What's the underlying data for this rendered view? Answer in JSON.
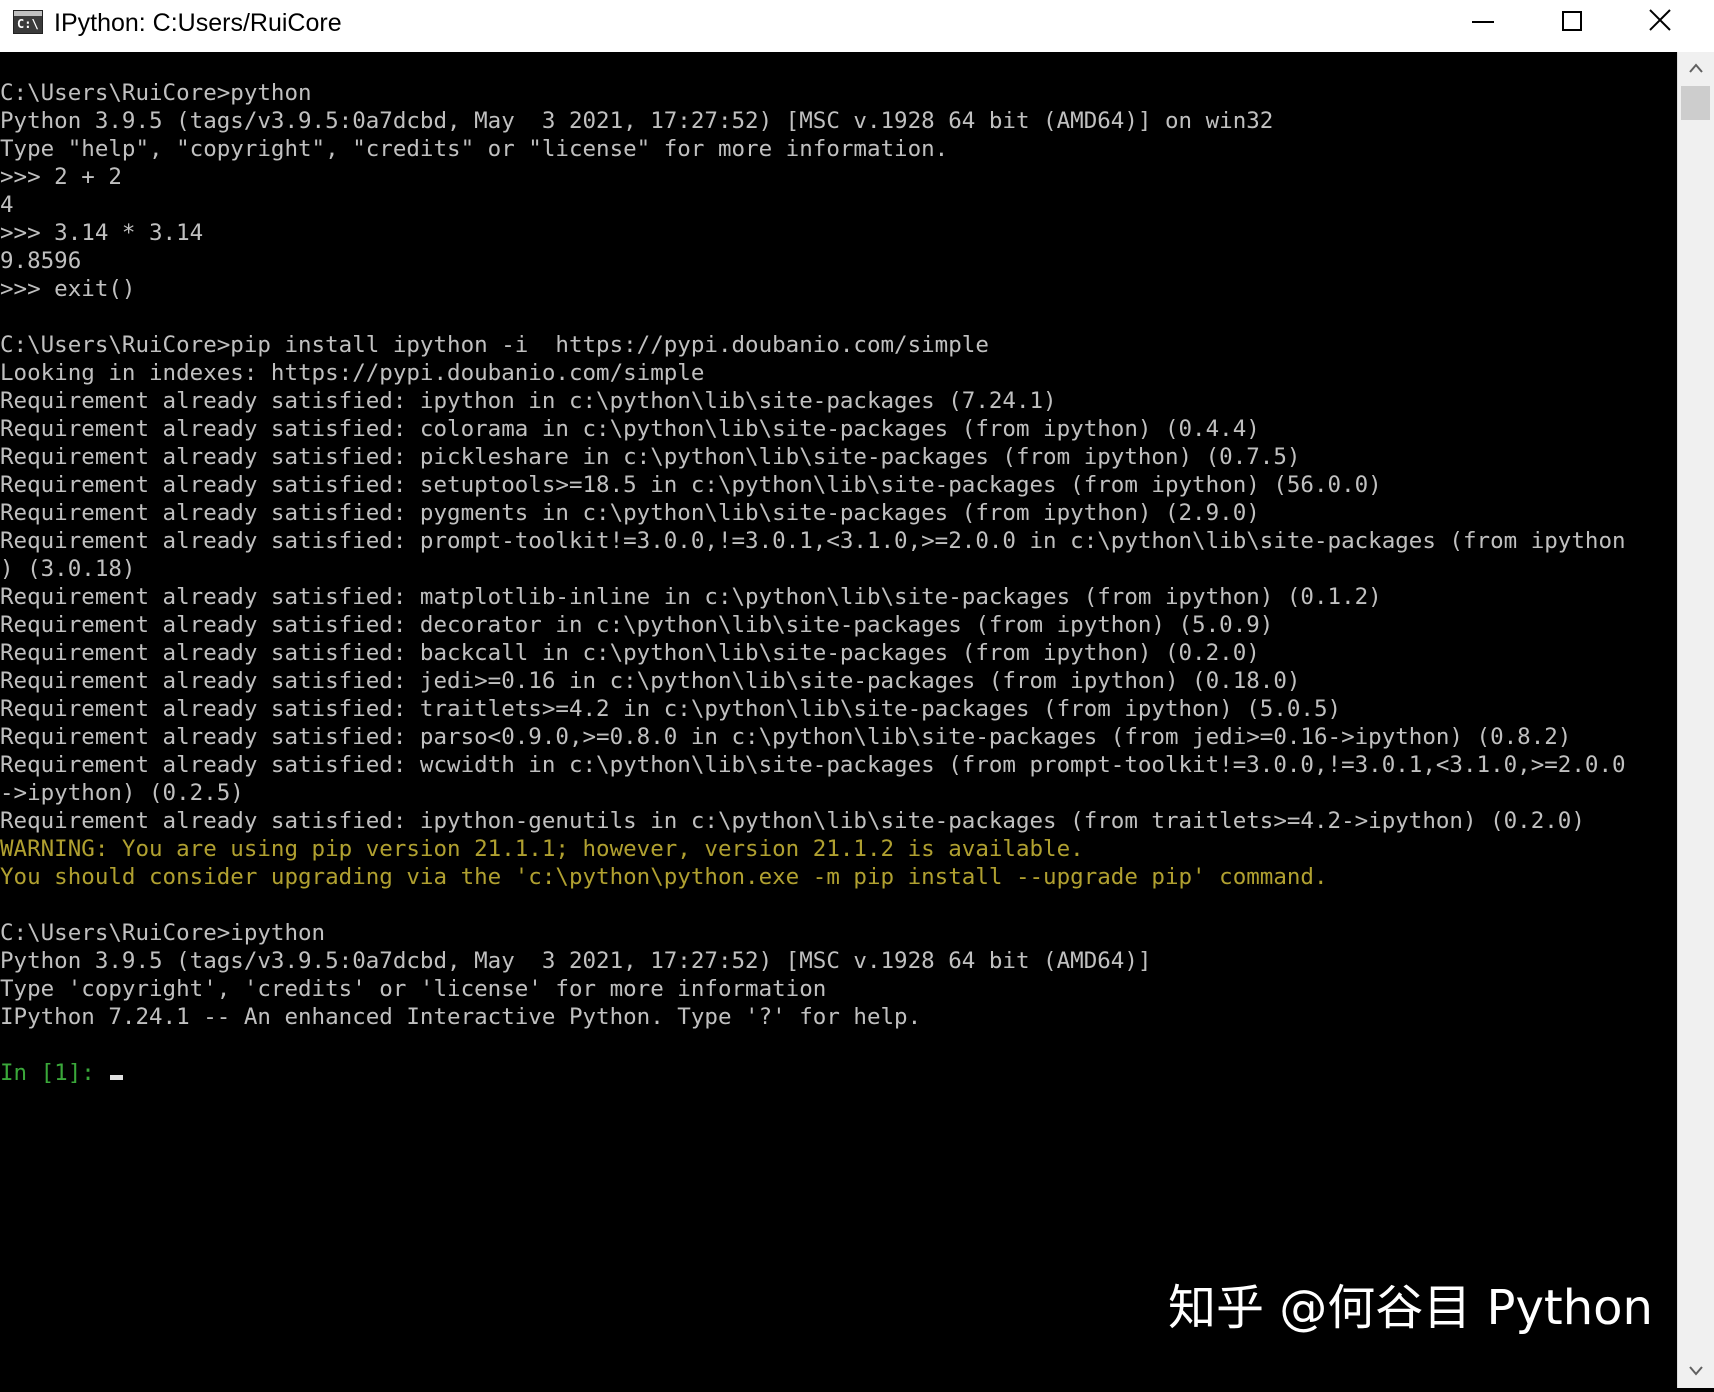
{
  "window": {
    "title": "IPython: C:Users/RuiCore",
    "icon_text": "C:\\"
  },
  "console": {
    "lines": [
      {
        "text": "C:\\Users\\RuiCore>python",
        "style": "normal"
      },
      {
        "text": "Python 3.9.5 (tags/v3.9.5:0a7dcbd, May  3 2021, 17:27:52) [MSC v.1928 64 bit (AMD64)] on win32",
        "style": "normal"
      },
      {
        "text": "Type \"help\", \"copyright\", \"credits\" or \"license\" for more information.",
        "style": "normal"
      },
      {
        "text": ">>> 2 + 2",
        "style": "normal"
      },
      {
        "text": "4",
        "style": "normal"
      },
      {
        "text": ">>> 3.14 * 3.14",
        "style": "normal"
      },
      {
        "text": "9.8596",
        "style": "normal"
      },
      {
        "text": ">>> exit()",
        "style": "normal"
      },
      {
        "text": "",
        "style": "normal"
      },
      {
        "text": "C:\\Users\\RuiCore>pip install ipython -i  https://pypi.doubanio.com/simple",
        "style": "normal"
      },
      {
        "text": "Looking in indexes: https://pypi.doubanio.com/simple",
        "style": "normal"
      },
      {
        "text": "Requirement already satisfied: ipython in c:\\python\\lib\\site-packages (7.24.1)",
        "style": "normal"
      },
      {
        "text": "Requirement already satisfied: colorama in c:\\python\\lib\\site-packages (from ipython) (0.4.4)",
        "style": "normal"
      },
      {
        "text": "Requirement already satisfied: pickleshare in c:\\python\\lib\\site-packages (from ipython) (0.7.5)",
        "style": "normal"
      },
      {
        "text": "Requirement already satisfied: setuptools>=18.5 in c:\\python\\lib\\site-packages (from ipython) (56.0.0)",
        "style": "normal"
      },
      {
        "text": "Requirement already satisfied: pygments in c:\\python\\lib\\site-packages (from ipython) (2.9.0)",
        "style": "normal"
      },
      {
        "text": "Requirement already satisfied: prompt-toolkit!=3.0.0,!=3.0.1,<3.1.0,>=2.0.0 in c:\\python\\lib\\site-packages (from ipython",
        "style": "normal"
      },
      {
        "text": ") (3.0.18)",
        "style": "normal"
      },
      {
        "text": "Requirement already satisfied: matplotlib-inline in c:\\python\\lib\\site-packages (from ipython) (0.1.2)",
        "style": "normal"
      },
      {
        "text": "Requirement already satisfied: decorator in c:\\python\\lib\\site-packages (from ipython) (5.0.9)",
        "style": "normal"
      },
      {
        "text": "Requirement already satisfied: backcall in c:\\python\\lib\\site-packages (from ipython) (0.2.0)",
        "style": "normal"
      },
      {
        "text": "Requirement already satisfied: jedi>=0.16 in c:\\python\\lib\\site-packages (from ipython) (0.18.0)",
        "style": "normal"
      },
      {
        "text": "Requirement already satisfied: traitlets>=4.2 in c:\\python\\lib\\site-packages (from ipython) (5.0.5)",
        "style": "normal"
      },
      {
        "text": "Requirement already satisfied: parso<0.9.0,>=0.8.0 in c:\\python\\lib\\site-packages (from jedi>=0.16->ipython) (0.8.2)",
        "style": "normal"
      },
      {
        "text": "Requirement already satisfied: wcwidth in c:\\python\\lib\\site-packages (from prompt-toolkit!=3.0.0,!=3.0.1,<3.1.0,>=2.0.0",
        "style": "normal"
      },
      {
        "text": "->ipython) (0.2.5)",
        "style": "normal"
      },
      {
        "text": "Requirement already satisfied: ipython-genutils in c:\\python\\lib\\site-packages (from traitlets>=4.2->ipython) (0.2.0)",
        "style": "normal"
      },
      {
        "text": "WARNING: You are using pip version 21.1.1; however, version 21.1.2 is available.",
        "style": "warn"
      },
      {
        "text": "You should consider upgrading via the 'c:\\python\\python.exe -m pip install --upgrade pip' command.",
        "style": "warn"
      },
      {
        "text": "",
        "style": "normal"
      },
      {
        "text": "C:\\Users\\RuiCore>ipython",
        "style": "normal"
      },
      {
        "text": "Python 3.9.5 (tags/v3.9.5:0a7dcbd, May  3 2021, 17:27:52) [MSC v.1928 64 bit (AMD64)]",
        "style": "normal"
      },
      {
        "text": "Type 'copyright', 'credits' or 'license' for more information",
        "style": "normal"
      },
      {
        "text": "IPython 7.24.1 -- An enhanced Interactive Python. Type '?' for help.",
        "style": "normal"
      }
    ],
    "prompt": "In [1]: ",
    "colors": {
      "background": "#000000",
      "text": "#c0c0c0",
      "warning": "#b0a030",
      "prompt": "#3aa83a"
    }
  },
  "watermark": {
    "text": "知乎 @何谷目 Python"
  }
}
